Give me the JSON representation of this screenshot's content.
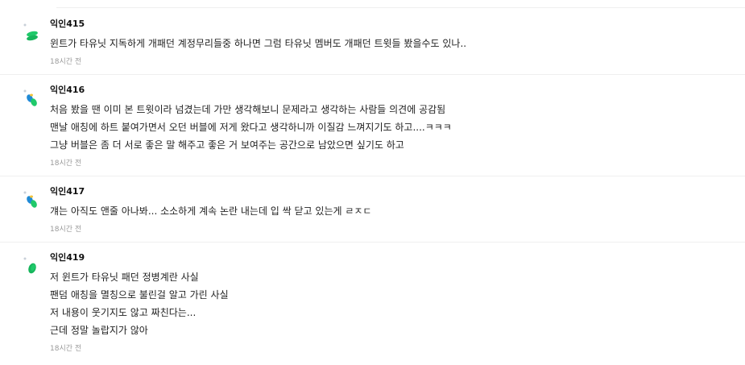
{
  "comments": [
    {
      "author": "익인415",
      "avatar_icon": "green-mint-avatar-icon",
      "lines": [
        "윈트가 타유닛 지독하게 개패던 계정무리들중 하나면 그럼 타유닛 멤버도 개패던 트윗들 봤을수도 있나.."
      ],
      "time": "18시간 전"
    },
    {
      "author": "익인416",
      "avatar_icon": "blue-green-avatar-icon",
      "lines": [
        "처음 봤을 땐 이미 본 트윗이라 넘겼는데 가만 생각해보니 문제라고 생각하는 사람들 의견에 공감됨",
        "맨날 애칭에 하트 붙여가면서 오던 버블에 저게 왔다고 생각하니까 이질감 느껴지기도 하고....ㅋㅋㅋ",
        "그냥 버블은 좀 더 서로 좋은 말 해주고 좋은 거 보여주는 공간으로 남았으면 싶기도 하고"
      ],
      "time": "18시간 전"
    },
    {
      "author": "익인417",
      "avatar_icon": "blue-green-avatar-icon",
      "lines": [
        "걔는 아직도 앤줄 아나봐... 소소하게 계속 논란 내는데 입 싹 닫고 있는게 ㄹㅈㄷ"
      ],
      "time": "18시간 전"
    },
    {
      "author": "익인419",
      "avatar_icon": "green-drop-avatar-icon",
      "lines": [
        "저 윈트가 타유닛 패던 정병계란 사실",
        "팬덤 애칭을 멸칭으로 불린걸 알고 가린 사실",
        "저 내용이 웃기지도 않고 짜친다는...",
        "근데 정말 놀랍지가 않아"
      ],
      "time": "18시간 전"
    }
  ],
  "colors": {
    "text": "#222222",
    "muted": "#9a9a9a",
    "divider": "#efefef",
    "green": "#1fc96a",
    "blue": "#1f8ad6"
  }
}
